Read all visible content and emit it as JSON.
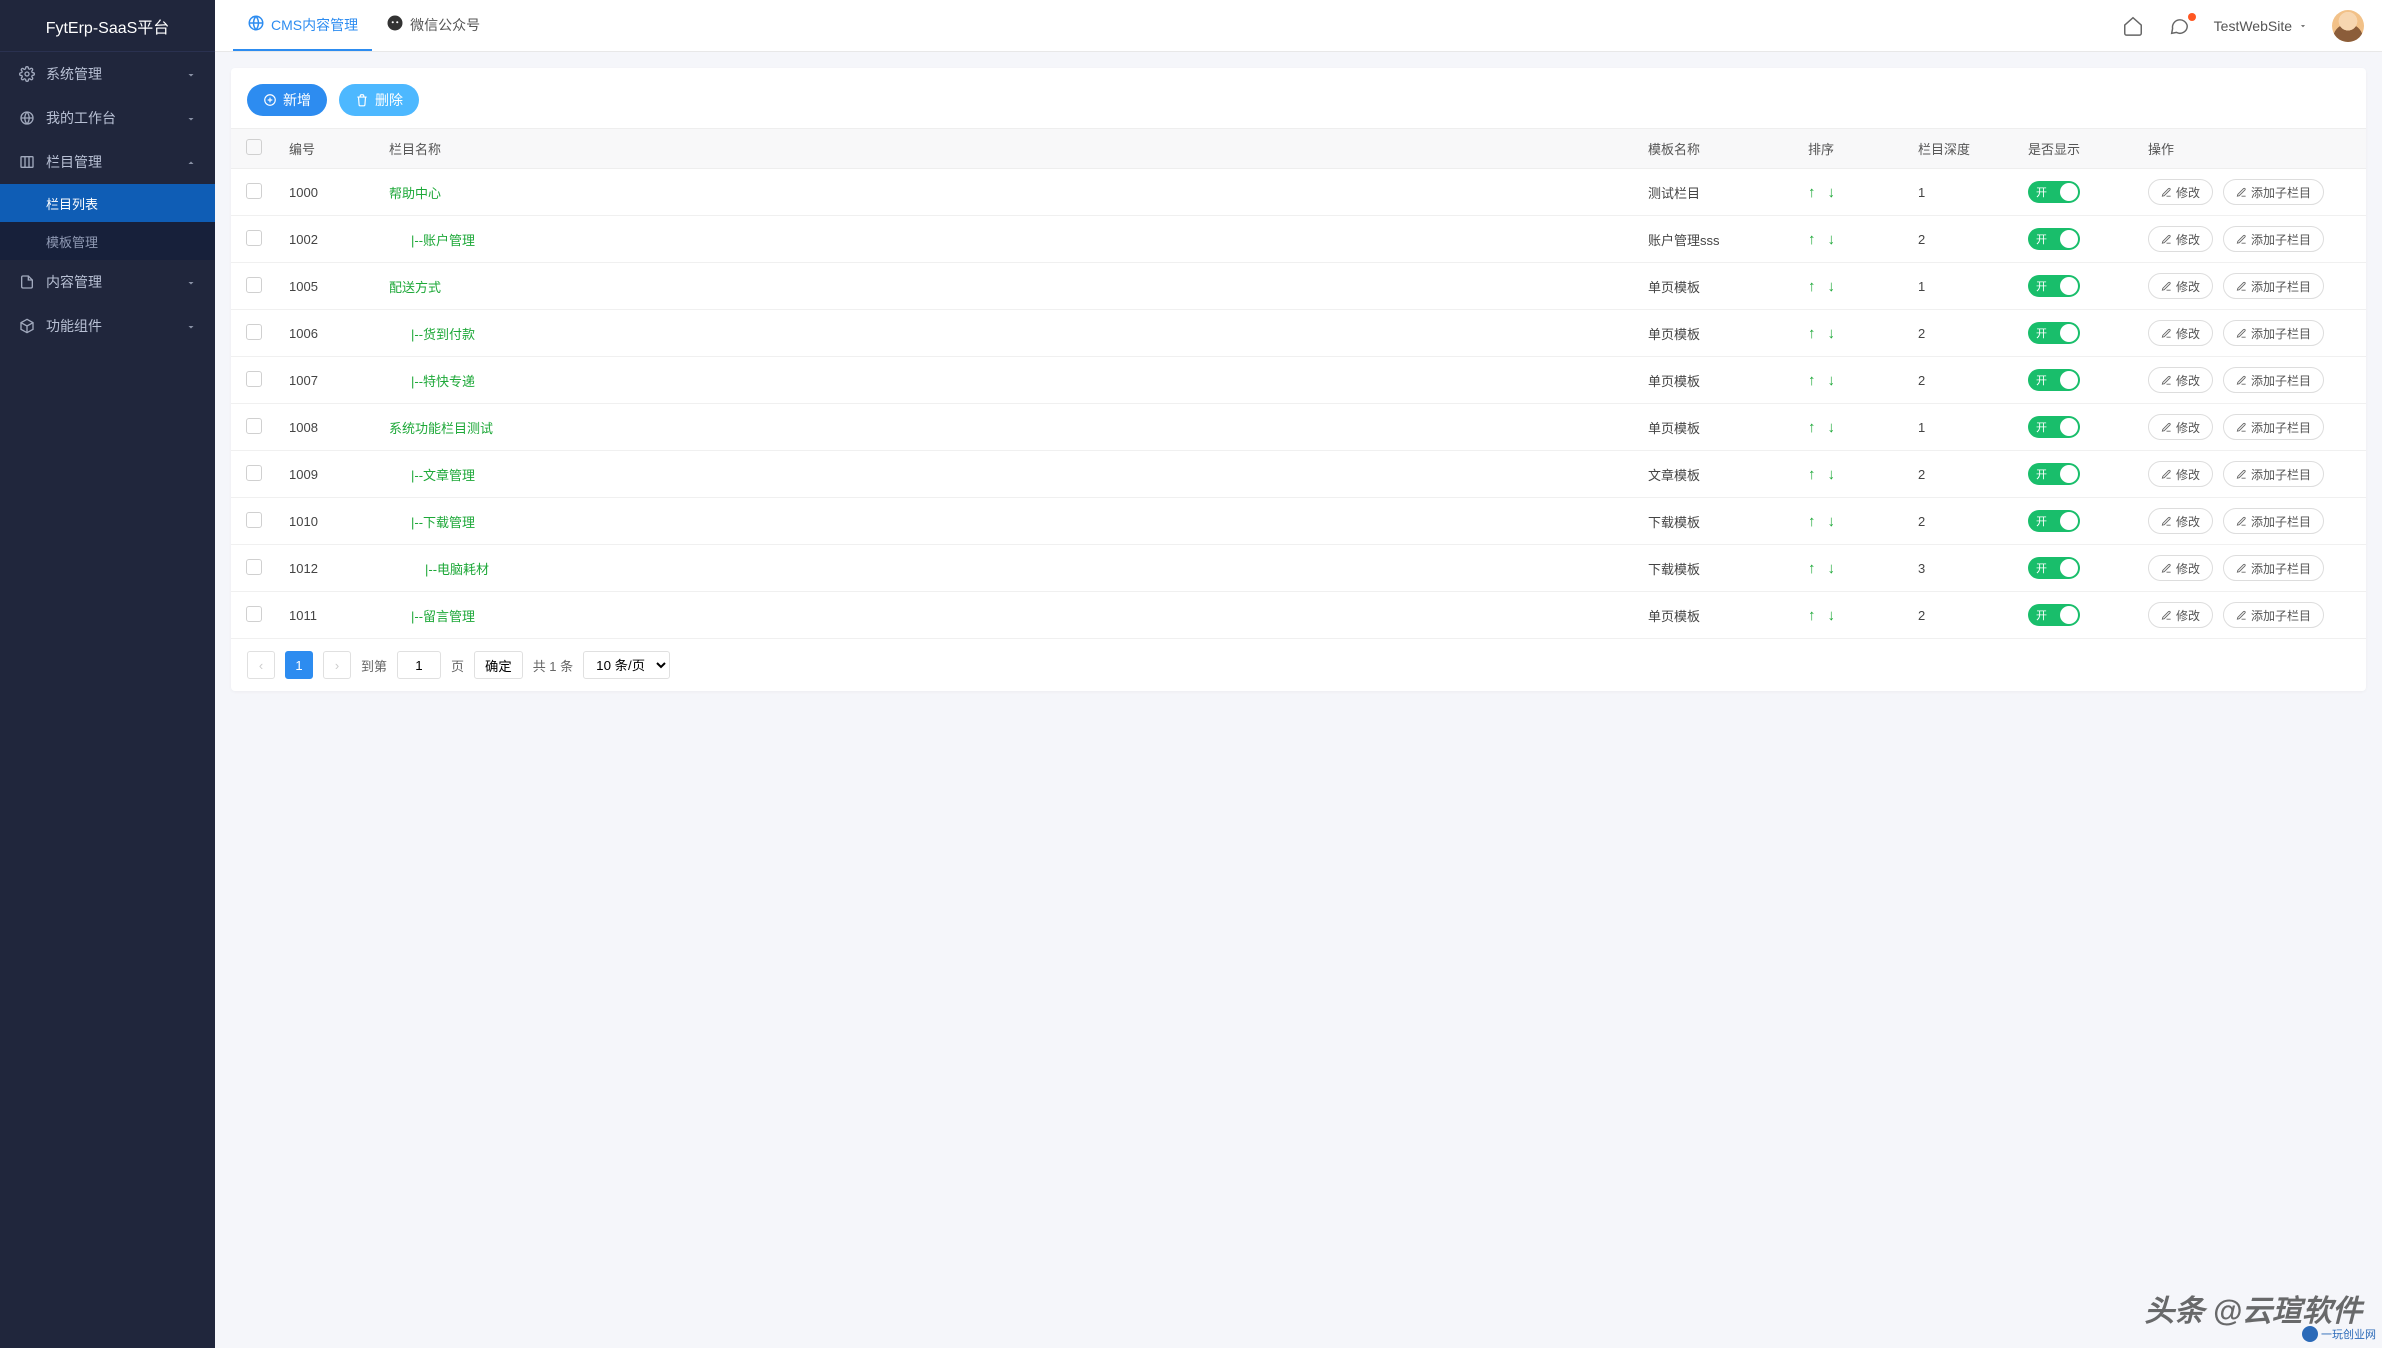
{
  "app": {
    "title": "FytErp-SaaS平台"
  },
  "topbar": {
    "tabs": [
      {
        "label": "CMS内容管理",
        "active": true
      },
      {
        "label": "微信公众号",
        "active": false
      }
    ],
    "user": {
      "name": "TestWebSite"
    }
  },
  "sidebar": {
    "items": [
      {
        "label": "系统管理",
        "icon": "gear",
        "expanded": false
      },
      {
        "label": "我的工作台",
        "icon": "globe",
        "expanded": false
      },
      {
        "label": "栏目管理",
        "icon": "columns",
        "expanded": true,
        "children": [
          {
            "label": "栏目列表",
            "active": true
          },
          {
            "label": "模板管理",
            "active": false
          }
        ]
      },
      {
        "label": "内容管理",
        "icon": "file",
        "expanded": false
      },
      {
        "label": "功能组件",
        "icon": "cube",
        "expanded": false
      }
    ]
  },
  "toolbar": {
    "add_label": "新增",
    "delete_label": "删除"
  },
  "table": {
    "headers": {
      "checkbox": "",
      "id": "编号",
      "name": "栏目名称",
      "template": "模板名称",
      "sort": "排序",
      "depth": "栏目深度",
      "display": "是否显示",
      "ops": "操作"
    },
    "switch_on_label": "开",
    "op_edit": "修改",
    "op_addchild": "添加子栏目",
    "rows": [
      {
        "id": "1000",
        "name": "帮助中心",
        "indent": 0,
        "template": "测试栏目",
        "depth": "1"
      },
      {
        "id": "1002",
        "name": "|--账户管理",
        "indent": 1,
        "template": "账户管理sss",
        "depth": "2"
      },
      {
        "id": "1005",
        "name": "配送方式",
        "indent": 0,
        "template": "单页模板",
        "depth": "1"
      },
      {
        "id": "1006",
        "name": "|--货到付款",
        "indent": 1,
        "template": "单页模板",
        "depth": "2"
      },
      {
        "id": "1007",
        "name": "|--特快专递",
        "indent": 1,
        "template": "单页模板",
        "depth": "2"
      },
      {
        "id": "1008",
        "name": "系统功能栏目测试",
        "indent": 0,
        "template": "单页模板",
        "depth": "1"
      },
      {
        "id": "1009",
        "name": "|--文章管理",
        "indent": 1,
        "template": "文章模板",
        "depth": "2"
      },
      {
        "id": "1010",
        "name": "|--下载管理",
        "indent": 1,
        "template": "下载模板",
        "depth": "2"
      },
      {
        "id": "1012",
        "name": "|--电脑耗材",
        "indent": 2,
        "template": "下载模板",
        "depth": "3"
      },
      {
        "id": "1011",
        "name": "|--留言管理",
        "indent": 1,
        "template": "单页模板",
        "depth": "2"
      }
    ]
  },
  "pagination": {
    "current": "1",
    "goto_prefix": "到第",
    "goto_value": "1",
    "goto_suffix": "页",
    "confirm": "确定",
    "total": "共 1 条",
    "pagesize": "10 条/页"
  },
  "watermark": {
    "main": "头条 @云瑄软件",
    "small": "一玩创业网"
  }
}
